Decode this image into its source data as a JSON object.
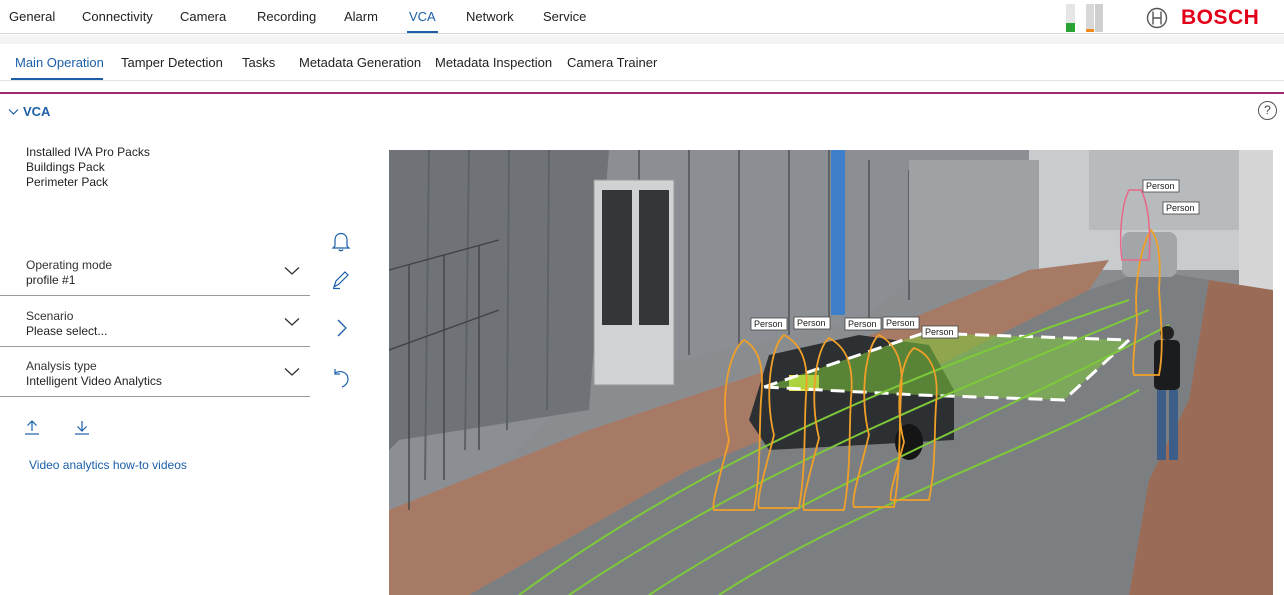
{
  "top_nav": {
    "tabs": [
      "General",
      "Connectivity",
      "Camera",
      "Recording",
      "Alarm",
      "VCA",
      "Network",
      "Service"
    ],
    "active": "VCA"
  },
  "brand": {
    "name": "BOSCH",
    "color": "#e2001a"
  },
  "sub_nav": {
    "tabs": [
      "Main Operation",
      "Tamper Detection",
      "Tasks",
      "Metadata Generation",
      "Metadata Inspection",
      "Camera Trainer"
    ],
    "active": "Main Operation"
  },
  "section": {
    "title": "VCA",
    "help": "?"
  },
  "packs": {
    "heading": "Installed IVA Pro Packs",
    "items": [
      "Buildings Pack",
      "Perimeter Pack"
    ]
  },
  "fields": {
    "operating_mode": {
      "label": "Operating mode",
      "value": "profile #1"
    },
    "scenario": {
      "label": "Scenario",
      "value": "Please select..."
    },
    "analysis_type": {
      "label": "Analysis type",
      "value": "Intelligent Video Analytics"
    }
  },
  "link": "Video analytics how-to videos",
  "video": {
    "object_labels": [
      "Person",
      "Person",
      "Person",
      "Person",
      "Person",
      "Person",
      "Person"
    ]
  },
  "colors": {
    "accent": "#1c5fa8",
    "divider": "#9e2a77",
    "track": "#7dc93a",
    "outline": "#f0a028"
  }
}
